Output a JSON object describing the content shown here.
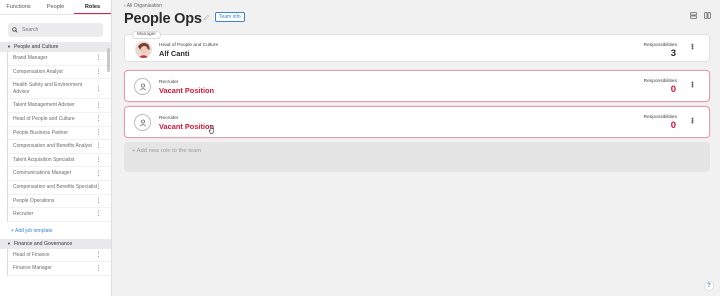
{
  "sidebar": {
    "tabs": [
      "Functions",
      "People",
      "Roles"
    ],
    "active_tab": "Roles",
    "search_placeholder": "Search",
    "groups": [
      {
        "name": "People and Culture",
        "roles": [
          "Brand Manager",
          "Compensation Analyst",
          "Health Safety and Environment Advisor",
          "Talent Management Adviser",
          "Head of People and Culture",
          "People Business Partner",
          "Compensation and Benefits Analyst",
          "Talent Acquisition Specialist",
          "Communications Manager",
          "Compensation and Benefits Specialist",
          "People Operations",
          "Recruiter"
        ],
        "add_label": "+ Add job template"
      },
      {
        "name": "Finance and Governance",
        "roles": [
          "Head of Finance",
          "Finance Manager"
        ]
      }
    ]
  },
  "header": {
    "breadcrumb": "All Organisation",
    "title": "People Ops",
    "team_info_label": "Team info"
  },
  "cards": [
    {
      "tag": "Manager",
      "role": "Head of People and Culture",
      "name": "Alf Canti",
      "resp_label": "Responsibilities",
      "resp_count": "3"
    },
    {
      "role": "Recruiter",
      "name": "Vacant Position",
      "resp_label": "Responsibilities",
      "resp_count": "0"
    },
    {
      "role": "Recruiter",
      "name": "Vacant Position",
      "resp_label": "Responsibilities",
      "resp_count": "0"
    }
  ],
  "add_role_label": "+ Add new role to the team",
  "help_label": "?",
  "colors": {
    "accent_red": "#c8183c",
    "link_blue": "#3a86c8",
    "background": "#f1f1f2"
  }
}
